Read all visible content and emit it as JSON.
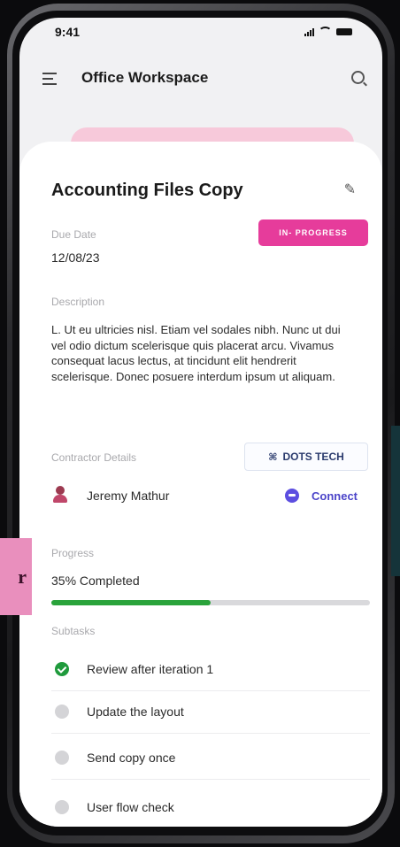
{
  "status_bar": {
    "time": "9:41"
  },
  "header": {
    "title": "Office Workspace",
    "menu_icon": "hamburger-menu-icon",
    "search_icon": "search-icon"
  },
  "task": {
    "title": "Accounting Files Copy",
    "edit_icon": "pencil-edit-icon",
    "due_date_label": "Due Date",
    "due_date": "12/08/23",
    "status": "IN- PROGRESS",
    "description_label": "Description",
    "description": "L. Ut eu ultricies nisl. Etiam vel sodales nibh. Nunc ut dui vel odio dictum scelerisque quis placerat arcu. Vivamus consequat lacus lectus, at tincidunt elit hendrerit scelerisque. Donec posuere interdum ipsum ut aliquam.",
    "contractor_label": "Contractor Details",
    "company_logo": "⌘",
    "company": "DOTS TECH",
    "contractor_name": "Jeremy Mathur",
    "connect_label": "Connect",
    "progress_label": "Progress",
    "progress_text": "35% Completed",
    "progress_fraction": 0.5,
    "subtasks_label": "Subtasks",
    "subtasks": [
      {
        "label": "Review after iteration 1",
        "done": true
      },
      {
        "label": "Update the layout",
        "done": false
      },
      {
        "label": "Send copy once",
        "done": false
      },
      {
        "label": "User flow check",
        "done": false
      }
    ]
  },
  "side_tab": {
    "text": "r"
  },
  "colors": {
    "accent_pink": "#e63c9b",
    "progress_green": "#2aa33b",
    "connect_purple": "#5c4ee0"
  }
}
